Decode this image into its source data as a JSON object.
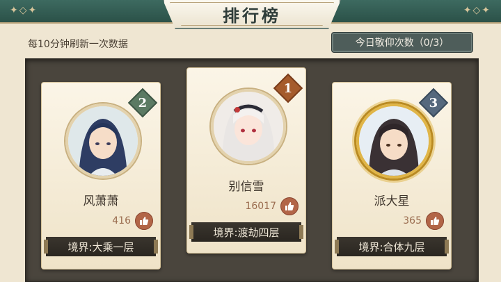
{
  "header": {
    "title": "排行榜",
    "refresh_text": "每10分钟刷新一次数据",
    "worship_count": "今日敬仰次数（0/3）"
  },
  "players": [
    {
      "rank": "2",
      "name": "风萧萧",
      "likes": "416",
      "realm": "境界:大乘一层"
    },
    {
      "rank": "1",
      "name": "别信雪",
      "likes": "16017",
      "realm": "境界:渡劫四层"
    },
    {
      "rank": "3",
      "name": "派大星",
      "likes": "365",
      "realm": "境界:合体九层"
    }
  ],
  "colors": {
    "banner": "#2b5148",
    "panel": "#4a453d",
    "card": "#fbf5e7",
    "like_text": "#9a6c4f",
    "thumb": "#b26547"
  },
  "icons": {
    "like": "thumb-up-icon",
    "banner_deco": "cloud-ornament-icon"
  }
}
